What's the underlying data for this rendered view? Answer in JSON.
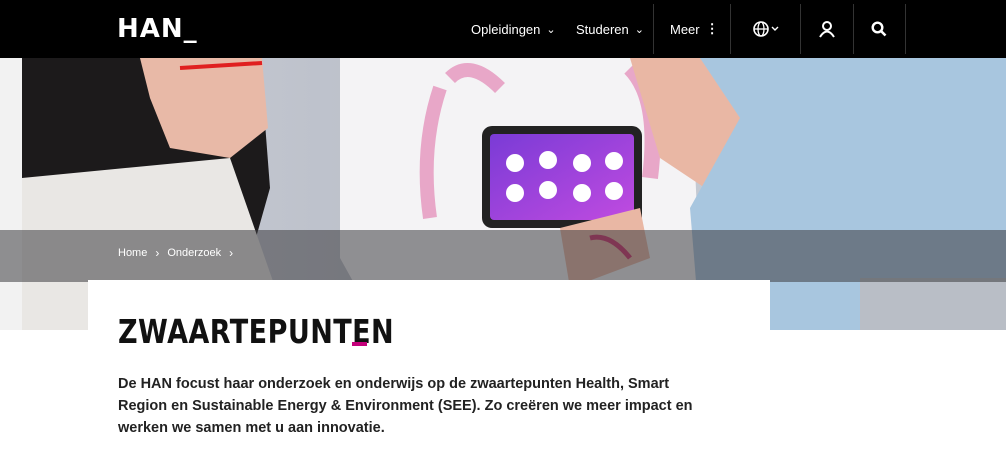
{
  "header": {
    "logo": "HAN_",
    "nav": {
      "opleidingen": "Opleidingen",
      "studeren": "Studeren",
      "meer": "Meer"
    },
    "icons": [
      "globe-icon",
      "user-icon",
      "search-icon"
    ]
  },
  "breadcrumb": {
    "home": "Home",
    "onderzoek": "Onderzoek"
  },
  "page": {
    "title": "ZWAARTEPUNTEN",
    "intro": "De HAN focust haar onderzoek en onderwijs op de zwaartepunten Health, Smart Region en Sustainable Energy & Environment (SEE). Zo creëren we meer impact en werken we samen met u aan innovatie."
  },
  "colors": {
    "accent": "#c4007a",
    "header_bg": "#000000"
  }
}
